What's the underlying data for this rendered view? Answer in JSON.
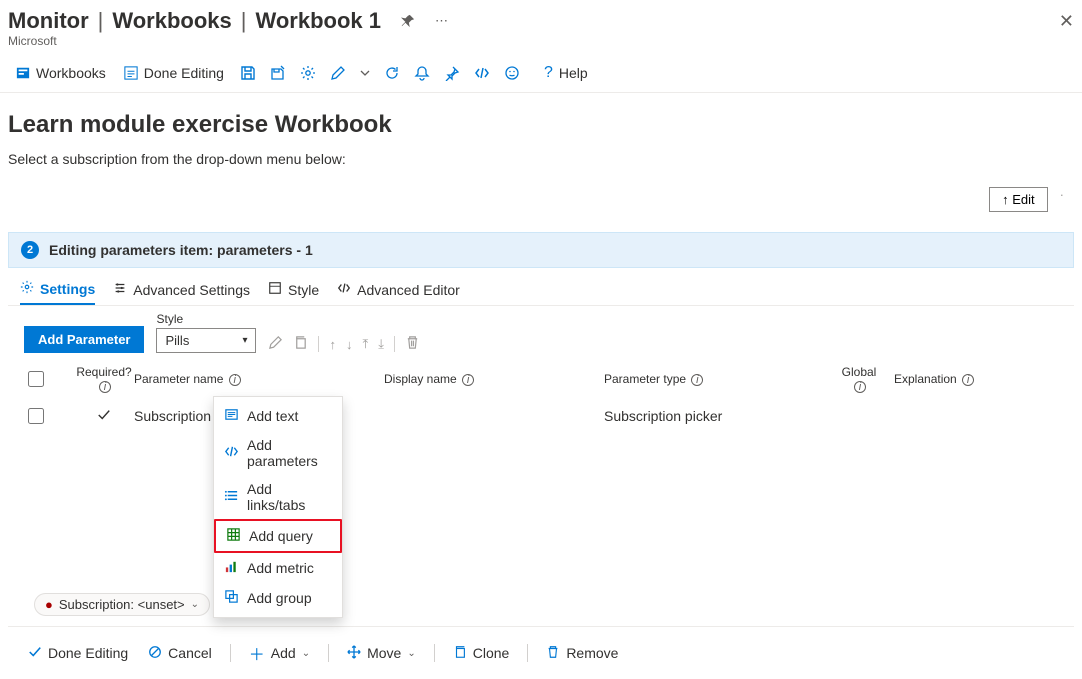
{
  "breadcrumb": {
    "a": "Monitor",
    "b": "Workbooks",
    "c": "Workbook 1"
  },
  "subtitle": "Microsoft",
  "toolbar": {
    "workbooks": "Workbooks",
    "done_editing": "Done Editing",
    "help": "Help"
  },
  "workbook": {
    "title": "Learn module exercise Workbook",
    "instruction": "Select a subscription from the drop-down menu below:"
  },
  "edit_btn": "↑ Edit",
  "banner": {
    "step": "2",
    "text": "Editing parameters item: parameters - 1"
  },
  "tabs": {
    "settings": "Settings",
    "advanced_settings": "Advanced Settings",
    "style": "Style",
    "advanced_editor": "Advanced Editor"
  },
  "param_bar": {
    "add_parameter": "Add Parameter",
    "style_label": "Style",
    "style_value": "Pills"
  },
  "columns": {
    "required": "Required?",
    "parameter_name": "Parameter name",
    "display_name": "Display name",
    "parameter_type": "Parameter type",
    "global": "Global",
    "explanation": "Explanation"
  },
  "row": {
    "name": "Subscription",
    "type": "Subscription picker"
  },
  "context_menu": {
    "add_text": "Add text",
    "add_parameters": "Add parameters",
    "add_links": "Add links/tabs",
    "add_query": "Add query",
    "add_metric": "Add metric",
    "add_group": "Add group"
  },
  "sub_pill": {
    "label": "Subscription:",
    "value": "<unset>"
  },
  "footer": {
    "done_editing": "Done Editing",
    "cancel": "Cancel",
    "add": "Add",
    "move": "Move",
    "clone": "Clone",
    "remove": "Remove"
  }
}
